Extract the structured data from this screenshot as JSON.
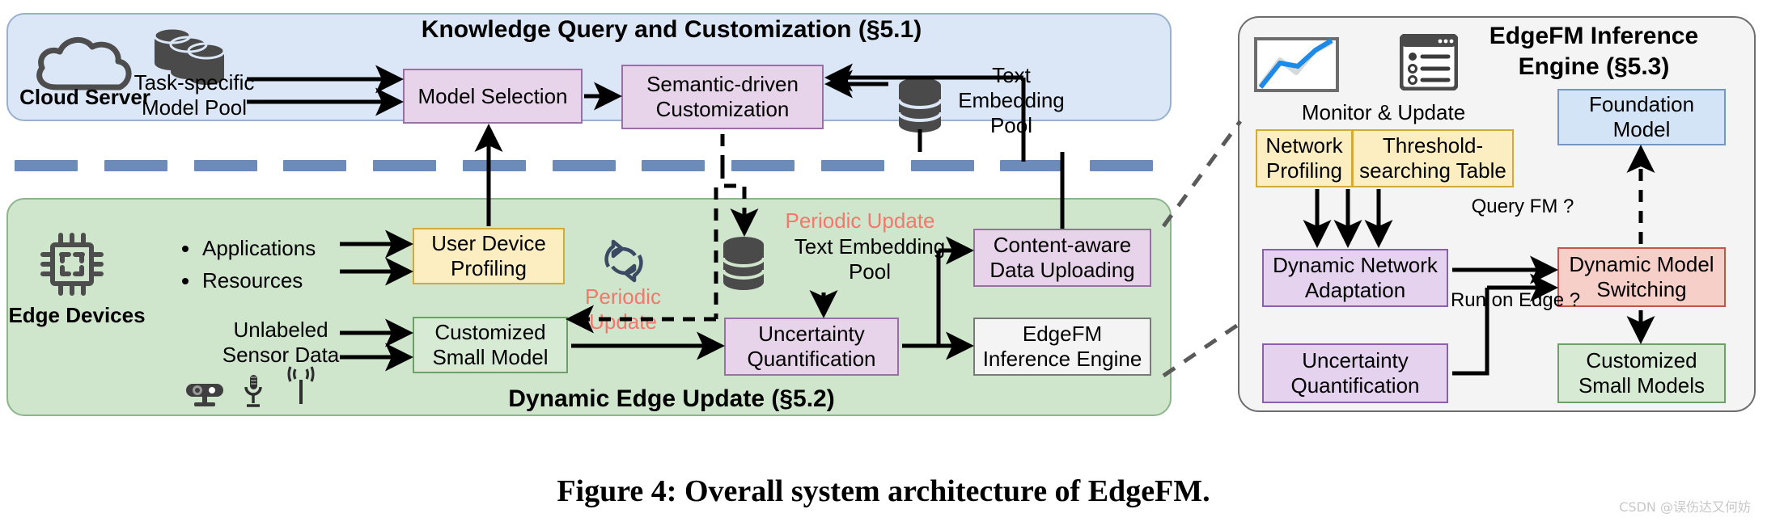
{
  "figure": {
    "caption": "Figure 4: Overall system architecture of EdgeFM.",
    "watermark": "CSDN @误伤达又何妨"
  },
  "cloud_panel": {
    "title": "Knowledge Query and Customization (§5.1)",
    "accent_color": "#dbe7f7",
    "actor_label": "Cloud Server",
    "actor_icon": "cloud-icon",
    "model_pool": {
      "icon": "database-stack-icon",
      "label_line1": "Task-specific",
      "label_line2": "Model Pool"
    },
    "nodes": [
      {
        "id": "model-selection",
        "label": "Model Selection",
        "color": "#e8d4ea"
      },
      {
        "id": "semantic-driven-customization",
        "label": "Semantic-driven\nCustomization",
        "color": "#e8d4ea"
      }
    ],
    "text_embedding_pool": {
      "icon": "database-icon",
      "label_line1": "Text",
      "label_line2": "Embedding",
      "label_line3": "Pool"
    }
  },
  "network_separator": {
    "name": "network-link-dashes",
    "dash_color": "#6c8bb8",
    "dash_count": 13
  },
  "edge_panel": {
    "title": "Dynamic Edge Update (§5.2)",
    "accent_color": "#cfe6cd",
    "actor_label": "Edge Devices",
    "actor_icon": "chip-icon",
    "sensor_icons": [
      "camera-icon",
      "microphone-icon",
      "wireless-signal-icon"
    ],
    "inputs": {
      "bullets": [
        "Applications",
        "Resources"
      ],
      "sensor_data_line1": "Unlabeled",
      "sensor_data_line2": "Sensor Data"
    },
    "periodic_update_badge": {
      "icon": "refresh-cycle-icon",
      "line1": "Periodic",
      "line2": "Update",
      "color": "#f4776c"
    },
    "periodic_update_top_label": "Periodic Update",
    "text_embedding_pool": {
      "icon": "database-icon",
      "label_line1": "Text Embedding",
      "label_line2": "Pool"
    },
    "nodes": [
      {
        "id": "user-device-profiling",
        "label": "User Device\nProfiling",
        "color": "#fdeec2"
      },
      {
        "id": "customized-small-model",
        "label": "Customized\nSmall Model",
        "color": "#d6ead4"
      },
      {
        "id": "uncertainty-quantification",
        "label": "Uncertainty\nQuantification",
        "color": "#e8d4ea"
      },
      {
        "id": "content-aware-data-uploading",
        "label": "Content-aware\nData Uploading",
        "color": "#e8d4ea"
      },
      {
        "id": "edgefm-inference-engine",
        "label": "EdgeFM\nInference Engine",
        "color": "#f4f4f4"
      }
    ]
  },
  "engine_panel": {
    "title": "EdgeFM Inference\nEngine (§5.3)",
    "accent_color": "#f4f4f4",
    "monitor": {
      "caption": "Monitor & Update",
      "icons": [
        "line-chart-icon",
        "table-list-icon"
      ]
    },
    "table_cells": [
      {
        "id": "network-profiling",
        "label": "Network\nProfiling",
        "color": "#fdeec2"
      },
      {
        "id": "threshold-searching-table",
        "label": "Threshold-\nsearching Table",
        "color": "#fdeec2"
      }
    ],
    "nodes": [
      {
        "id": "dynamic-network-adaptation",
        "label": "Dynamic Network\nAdaptation",
        "color": "#e4d2ef"
      },
      {
        "id": "uncertainty-quantification-engine",
        "label": "Uncertainty\nQuantification",
        "color": "#e4d2ef"
      },
      {
        "id": "foundation-model",
        "label": "Foundation\nModel",
        "color": "#d4e4f7"
      },
      {
        "id": "dynamic-model-switching",
        "label": "Dynamic Model\nSwitching",
        "color": "#f7cfc9"
      },
      {
        "id": "customized-small-models",
        "label": "Customized\nSmall Models",
        "color": "#d6ead4"
      }
    ],
    "decision_labels": [
      {
        "id": "query-fm-label",
        "text": "Query FM ?"
      },
      {
        "id": "run-on-edge-label",
        "text": "Run on Edge ?"
      }
    ]
  }
}
